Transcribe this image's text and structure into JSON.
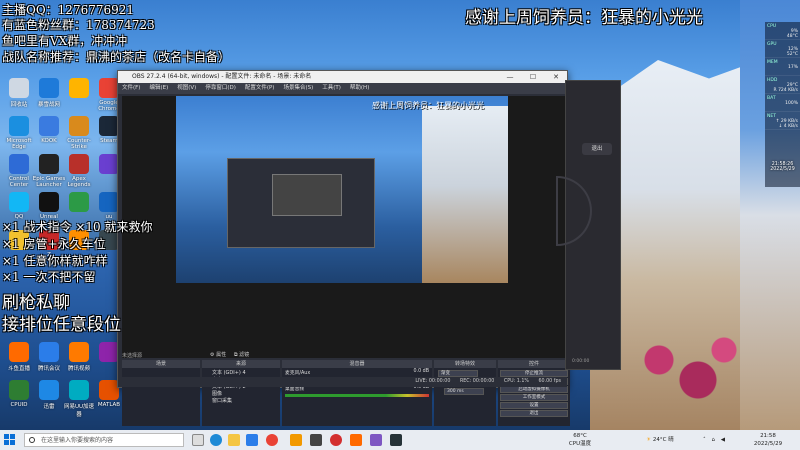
{
  "overlay": {
    "line1": "主播QQ：1276776921",
    "line2": "有蓝色粉丝群：178374723",
    "line3": "鱼吧里有VX群，冲冲冲",
    "line4": "战队名称推荐：鼎沸的茶店（改名卡自备）",
    "thanks": "感谢上周饲养员：狂暴的小光光",
    "gift1": "×1 战术指令 ×10 就来救你",
    "gift2": "×1 房管+永久车位",
    "gift3": "×1 任意你样就咋样",
    "gift4": "×1 一次不把不留",
    "promo1": "刷枪私聊",
    "promo2": "接排位任意段位"
  },
  "desktop": {
    "icons": [
      {
        "label": "回收站",
        "color": "#cfd8e3"
      },
      {
        "label": "暴雪战网",
        "color": "#1e7ad9"
      },
      {
        "label": "",
        "color": "#ffb400"
      },
      {
        "label": "Google Chrome",
        "color": "#e94235"
      },
      {
        "label": "Microsoft Edge",
        "color": "#1b8fe0"
      },
      {
        "label": "KOOK",
        "color": "#3a7be0"
      },
      {
        "label": "Counter-Strike",
        "color": "#d98a1c"
      },
      {
        "label": "Steam",
        "color": "#1b2838"
      },
      {
        "label": "Control Center",
        "color": "#2e6bd6"
      },
      {
        "label": "Epic Games Launcher",
        "color": "#222222"
      },
      {
        "label": "Apex Legends",
        "color": "#b8302a"
      },
      {
        "label": "",
        "color": "#6a3fd0"
      },
      {
        "label": "QQ",
        "color": "#12b7f5"
      },
      {
        "label": "Unreal",
        "color": "#111111"
      },
      {
        "label": "",
        "color": "#2c9a46"
      },
      {
        "label": "uu",
        "color": "#1565c0"
      },
      {
        "label": "",
        "color": "#f2c12e"
      },
      {
        "label": "Z",
        "color": "#c62828"
      },
      {
        "label": "",
        "color": "#ff8f00"
      },
      {
        "label": "",
        "color": "#37474f"
      },
      {
        "label": "斗鱼直播",
        "color": "#ff6a00"
      },
      {
        "label": "腾讯会议",
        "color": "#2b7de9"
      },
      {
        "label": "腾讯视频",
        "color": "#ff7a00"
      },
      {
        "label": "",
        "color": "#8e24aa"
      },
      {
        "label": "CPUID",
        "color": "#2e7d32"
      },
      {
        "label": "迅雷",
        "color": "#1e88e5"
      },
      {
        "label": "网易UU加速器",
        "color": "#00acc1"
      },
      {
        "label": "MATLAB",
        "color": "#e65100"
      }
    ]
  },
  "obs": {
    "title": "OBS 27.2.4 (64-bit, windows) - 配置文件: 未命名 - 场景: 未命名",
    "win_min": "—",
    "win_max": "☐",
    "win_close": "✕",
    "menu": [
      "文件(F)",
      "编辑(E)",
      "视图(V)",
      "停靠窗口(D)",
      "配置文件(P)",
      "场景集合(S)",
      "工具(T)",
      "帮助(H)"
    ],
    "preview_text": "感谢上周饲养员：狂暴的小光光",
    "panels": {
      "scenes": "场景",
      "sources": "来源",
      "mixer": "混音器",
      "transitions": "转场特效",
      "controls": "控件"
    },
    "no_source": "未选择源",
    "properties_btn": "属性",
    "filters_btn": "滤镜",
    "sources": [
      "文本 (GDI+) 4",
      "文本 (GDI+) 3",
      "文本 (GDI+) 2",
      "图像",
      "窗口采集"
    ],
    "mixer": [
      {
        "name": "麦克风/Aux",
        "db": "0.0 dB"
      },
      {
        "name": "桌面音频",
        "db": "0.0 dB"
      }
    ],
    "transition_type": "渐变",
    "duration_label": "时长",
    "duration_value": "300 ms",
    "controls": [
      "停止推流",
      "开始录制",
      "启动虚拟摄像机",
      "工作室模式",
      "设置",
      "退出"
    ],
    "status": {
      "live_time": "LIVE: 00:00:00",
      "rec_time": "REC: 00:00:00",
      "cpu": "CPU: 1.1%",
      "fps": "60.00 fps"
    }
  },
  "side_app": {
    "button": "退出",
    "footer": "0:00:00"
  },
  "hw_monitor": [
    {
      "label": "CPU",
      "value": "9%",
      "sub": "48°C"
    },
    {
      "label": "GPU",
      "value": "12%",
      "sub": "52°C"
    },
    {
      "label": "MEM",
      "value": "17%",
      "sub": ""
    },
    {
      "label": "HDD",
      "value": "29°C",
      "sub": "R 724 KB/s"
    },
    {
      "label": "BAT",
      "value": "100%",
      "sub": ""
    },
    {
      "label": "NET",
      "value": "↑ 29 KB/s",
      "sub": "↓ 4 KB/s"
    }
  ],
  "clock_widget": {
    "time": "21:58:26",
    "date": "2022/5/29"
  },
  "taskbar": {
    "search_placeholder": "在这里输入你要搜索的内容",
    "cpu_temp": "68°C",
    "cpu_label": "CPU温度",
    "weather": "24°C",
    "weather_desc": "晴",
    "time": "21:58",
    "date": "2022/5/29"
  }
}
